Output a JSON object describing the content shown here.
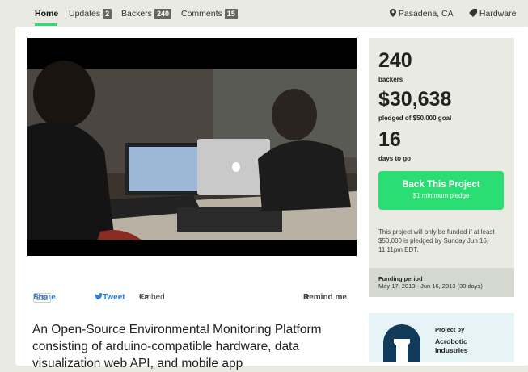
{
  "nav": {
    "home": "Home",
    "updates": "Updates",
    "updates_count": "2",
    "backers": "Backers",
    "backers_count": "240",
    "comments": "Comments",
    "comments_count": "15",
    "location": "Pasadena, CA",
    "category": "Hardware"
  },
  "share": {
    "share_label": "Share",
    "share_count": "832",
    "tweet_label": "Tweet",
    "embed_label": "Embed",
    "remind_label": "Remind me"
  },
  "project": {
    "title": "An Open-Source Environmental Monitoring Platform consisting of arduino-compatible hardware, data visualization web API, and mobile app"
  },
  "stats": {
    "backers_value": "240",
    "backers_label": "backers",
    "pledged_value": "$30,638",
    "pledged_label": "pledged of $50,000 goal",
    "days_value": "16",
    "days_label": "days to go"
  },
  "cta": {
    "label": "Back This Project",
    "sub": "$1 minimum pledge"
  },
  "note": "This project will only be funded if at least $50,000 is pledged by Sunday Jun 16, 11:11pm EDT.",
  "funding": {
    "heading": "Funding period",
    "value": "May 17, 2013 - Jun 16, 2013 (30 days)"
  },
  "creator": {
    "by": "Project by",
    "name": "Acrobotic Industries"
  },
  "colors": {
    "accent": "#2bde73",
    "link": "#2d7fd0"
  }
}
